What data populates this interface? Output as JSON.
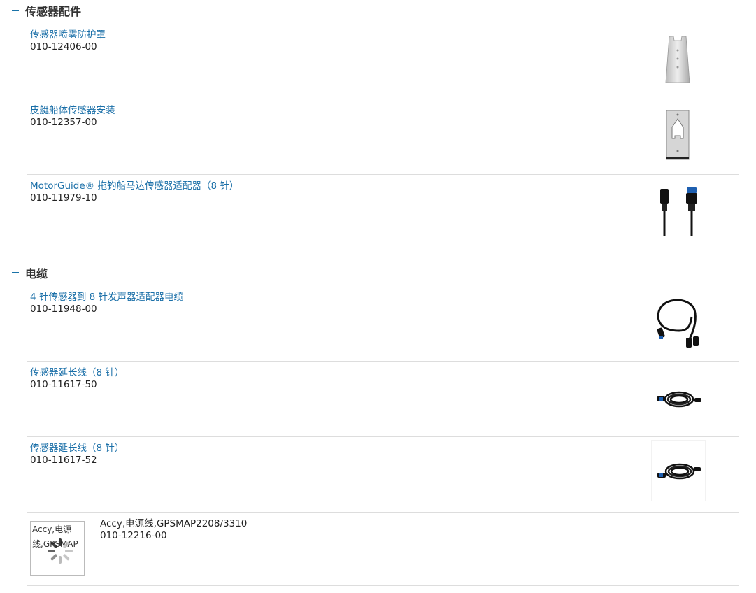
{
  "sections": [
    {
      "title": "传感器配件",
      "items": [
        {
          "name": "传感器喷雾防护罩",
          "part": "010-12406-00",
          "icon": "spray-shield-icon"
        },
        {
          "name": "皮艇船体传感器安装",
          "part": "010-12357-00",
          "icon": "mount-plate-icon"
        },
        {
          "name": "MotorGuide® 拖钓船马达传感器适配器（8 针）",
          "part": "010-11979-10",
          "icon": "connector-pair-icon"
        }
      ]
    },
    {
      "title": "电缆",
      "items": [
        {
          "name": "4 针传感器到 8 针发声器适配器电缆",
          "part": "010-11948-00",
          "icon": "y-cable-icon"
        },
        {
          "name": "传感器延长线（8 针）",
          "part": "010-11617-50",
          "icon": "coiled-cable-icon"
        },
        {
          "name": "传感器延长线（8 针）",
          "part": "010-11617-52",
          "icon": "coiled-cable-icon"
        },
        {
          "name": "Accy,电源线,GPSMAP2208/3310",
          "part": "010-12216-00",
          "image_alt": "Accy,电源线,GPSMAP",
          "icon": "loading-spinner-icon"
        }
      ]
    }
  ]
}
